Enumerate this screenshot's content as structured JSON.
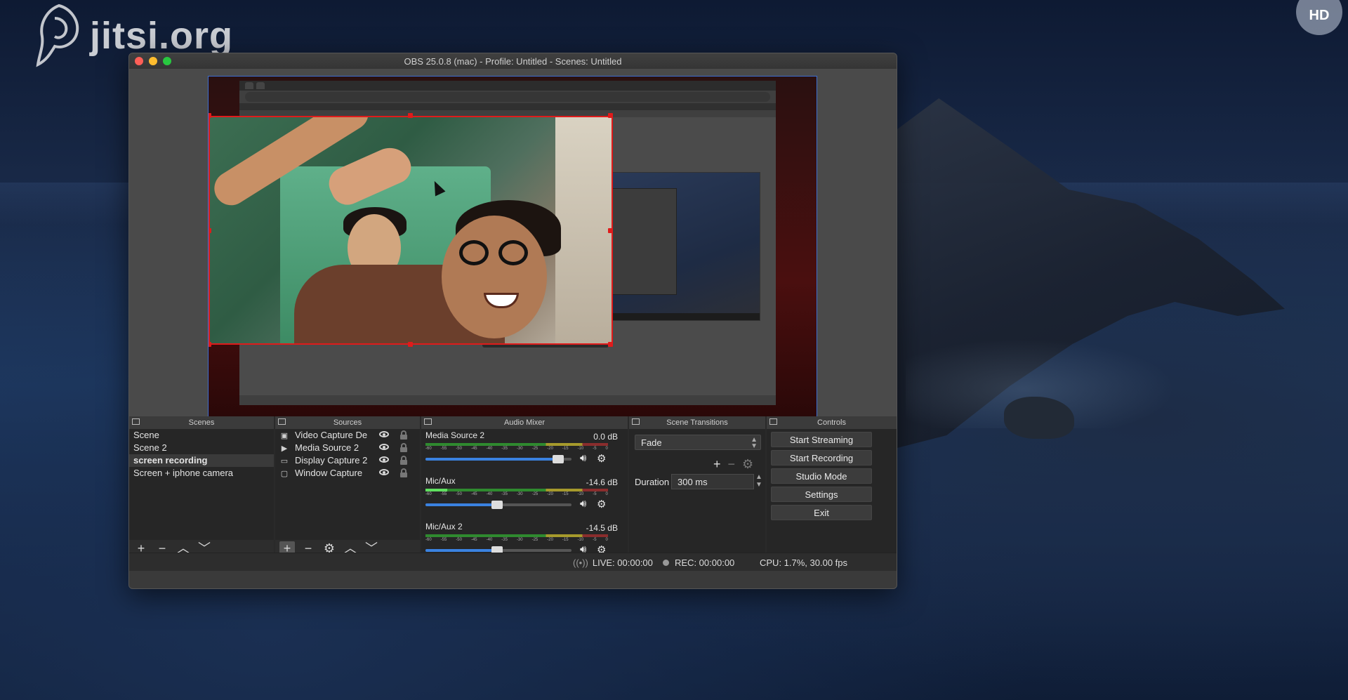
{
  "overlay": {
    "brand": "jitsi.org",
    "quality_badge": "HD"
  },
  "window": {
    "title": "OBS 25.0.8 (mac) - Profile: Untitled - Scenes: Untitled"
  },
  "docks": {
    "scenes": {
      "title": "Scenes",
      "items": [
        "Scene",
        "Scene 2",
        "screen recording",
        "Screen + iphone camera"
      ],
      "selected": "screen recording"
    },
    "sources": {
      "title": "Sources",
      "items": [
        {
          "name": "Video Capture De",
          "icon": "camera-icon"
        },
        {
          "name": "Media Source 2",
          "icon": "play-icon"
        },
        {
          "name": "Display Capture 2",
          "icon": "monitor-icon"
        },
        {
          "name": "Window Capture",
          "icon": "window-icon"
        }
      ]
    },
    "audio_mixer": {
      "title": "Audio Mixer",
      "ticks": [
        "-60",
        "-55",
        "-50",
        "-45",
        "-40",
        "-35",
        "-30",
        "-25",
        "-20",
        "-15",
        "-10",
        "-5",
        "0"
      ],
      "channels": [
        {
          "name": "Media Source 2",
          "db": "0.0 dB",
          "volume": 0.92,
          "level": 0.0
        },
        {
          "name": "Mic/Aux",
          "db": "-14.6 dB",
          "volume": 0.5,
          "level": 0.12
        },
        {
          "name": "Mic/Aux 2",
          "db": "-14.5 dB",
          "volume": 0.5,
          "level": 0.0
        }
      ]
    },
    "scene_transitions": {
      "title": "Scene Transitions",
      "selected": "Fade",
      "duration_label": "Duration",
      "duration_value": "300 ms"
    },
    "controls": {
      "title": "Controls",
      "buttons": [
        "Start Streaming",
        "Start Recording",
        "Studio Mode",
        "Settings",
        "Exit"
      ]
    }
  },
  "status": {
    "live": "LIVE: 00:00:00",
    "rec": "REC: 00:00:00",
    "cpu": "CPU: 1.7%, 30.00 fps"
  },
  "colors": {
    "selection_outline": "#e01b1b",
    "canvas_border": "#3b6fd3",
    "accent": "#3a82e0"
  }
}
